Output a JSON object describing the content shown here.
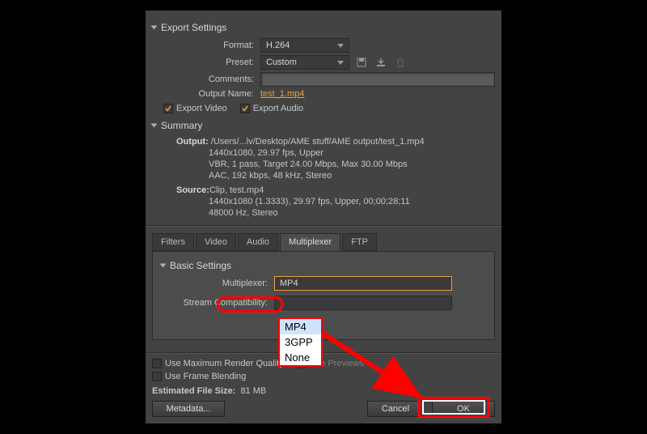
{
  "exportSettings": {
    "title": "Export Settings",
    "format": {
      "label": "Format:",
      "value": "H.264"
    },
    "preset": {
      "label": "Preset:",
      "value": "Custom"
    },
    "comments": {
      "label": "Comments:",
      "value": ""
    },
    "outputName": {
      "label": "Output Name:",
      "value": "test_1.mp4"
    },
    "exportVideo": {
      "label": "Export Video",
      "checked": true
    },
    "exportAudio": {
      "label": "Export Audio",
      "checked": true
    }
  },
  "summary": {
    "title": "Summary",
    "outputLabel": "Output:",
    "outputLines": [
      "/Users/...lv/Desktop/AME stuff/AME output/test_1.mp4",
      "1440x1080, 29.97 fps, Upper",
      "VBR, 1 pass, Target 24.00 Mbps, Max 30.00 Mbps",
      "AAC, 192 kbps, 48 kHz, Stereo"
    ],
    "sourceLabel": "Source:",
    "sourceLines": [
      "Clip, test.mp4",
      "1440x1080 (1.3333), 29.97 fps, Upper, 00;00;28;11",
      "48000 Hz, Stereo"
    ]
  },
  "tabs": [
    "Filters",
    "Video",
    "Audio",
    "Multiplexer",
    "FTP"
  ],
  "activeTabIndex": 3,
  "basicSettings": {
    "title": "Basic Settings",
    "multiplexer": {
      "label": "Multiplexer:",
      "value": "MP4"
    },
    "streamCompat": {
      "label": "Stream Compatibility:",
      "value": ""
    },
    "options": [
      "MP4",
      "3GPP",
      "None"
    ]
  },
  "renderOptions": {
    "maxRenderQuality": {
      "label": "Use Maximum Render Quality",
      "checked": false
    },
    "usePreviews": {
      "label": "Use Previews",
      "checked": false,
      "disabled": true
    },
    "frameBlending": {
      "label": "Use Frame Blending",
      "checked": false
    },
    "fileSizeLabel": "Estimated File Size:",
    "fileSizeValue": "81 MB"
  },
  "buttons": {
    "metadata": "Metadata...",
    "cancel": "Cancel",
    "ok": "OK"
  },
  "annotation": {
    "color": "#ff0000"
  }
}
